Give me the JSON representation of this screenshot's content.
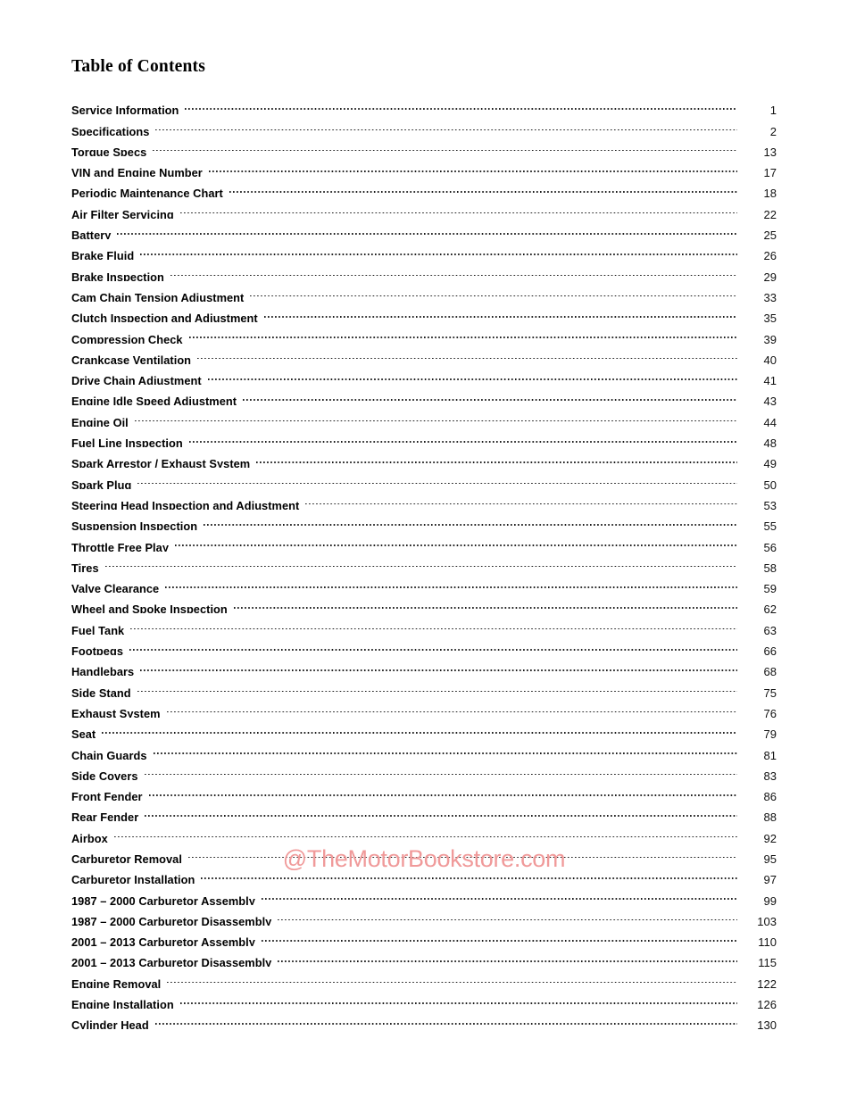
{
  "document": {
    "title": "Table of Contents"
  },
  "watermark": {
    "text": "@TheMotorBookstore.com",
    "color": "#f09a9a"
  },
  "toc": {
    "entries": [
      {
        "label": "Service Information",
        "page": "1"
      },
      {
        "label": "Specifications",
        "page": "2"
      },
      {
        "label": "Torque Specs",
        "page": "13"
      },
      {
        "label": "VIN and Engine Number",
        "page": "17"
      },
      {
        "label": "Periodic Maintenance Chart",
        "page": "18"
      },
      {
        "label": "Air Filter Servicing",
        "page": "22"
      },
      {
        "label": "Battery",
        "page": "25"
      },
      {
        "label": "Brake Fluid",
        "page": "26"
      },
      {
        "label": "Brake Inspection",
        "page": "29"
      },
      {
        "label": "Cam Chain Tension Adjustment",
        "page": "33"
      },
      {
        "label": "Clutch Inspection and Adjustment",
        "page": "35"
      },
      {
        "label": "Compression Check",
        "page": "39"
      },
      {
        "label": "Crankcase Ventilation",
        "page": "40"
      },
      {
        "label": "Drive Chain Adjustment",
        "page": "41"
      },
      {
        "label": "Engine Idle Speed Adjustment",
        "page": "43"
      },
      {
        "label": "Engine Oil",
        "page": "44"
      },
      {
        "label": "Fuel Line Inspection",
        "page": "48"
      },
      {
        "label": "Spark Arrestor / Exhaust System",
        "page": "49"
      },
      {
        "label": "Spark Plug",
        "page": "50"
      },
      {
        "label": "Steering Head Inspection and Adjustment",
        "page": "53"
      },
      {
        "label": "Suspension Inspection",
        "page": "55"
      },
      {
        "label": "Throttle Free Play",
        "page": "56"
      },
      {
        "label": "Tires",
        "page": "58"
      },
      {
        "label": "Valve Clearance",
        "page": "59"
      },
      {
        "label": "Wheel and Spoke Inspection",
        "page": "62"
      },
      {
        "label": "Fuel Tank",
        "page": "63"
      },
      {
        "label": "Footpegs",
        "page": "66"
      },
      {
        "label": "Handlebars",
        "page": "68"
      },
      {
        "label": "Side Stand",
        "page": "75"
      },
      {
        "label": "Exhaust System",
        "page": "76"
      },
      {
        "label": "Seat",
        "page": "79"
      },
      {
        "label": "Chain Guards",
        "page": "81"
      },
      {
        "label": "Side Covers",
        "page": "83"
      },
      {
        "label": "Front Fender",
        "page": "86"
      },
      {
        "label": "Rear Fender",
        "page": "88"
      },
      {
        "label": "Airbox",
        "page": "92"
      },
      {
        "label": "Carburetor Removal",
        "page": "95"
      },
      {
        "label": "Carburetor Installation",
        "page": "97"
      },
      {
        "label": "1987 – 2000 Carburetor Assembly",
        "page": "99"
      },
      {
        "label": "1987 – 2000 Carburetor Disassembly",
        "page": "103"
      },
      {
        "label": "2001 – 2013 Carburetor Assembly",
        "page": "110"
      },
      {
        "label": "2001 – 2013 Carburetor Disassembly",
        "page": "115"
      },
      {
        "label": "Engine Removal",
        "page": "122"
      },
      {
        "label": "Engine Installation",
        "page": "126"
      },
      {
        "label": "Cylinder Head",
        "page": "130"
      }
    ]
  }
}
